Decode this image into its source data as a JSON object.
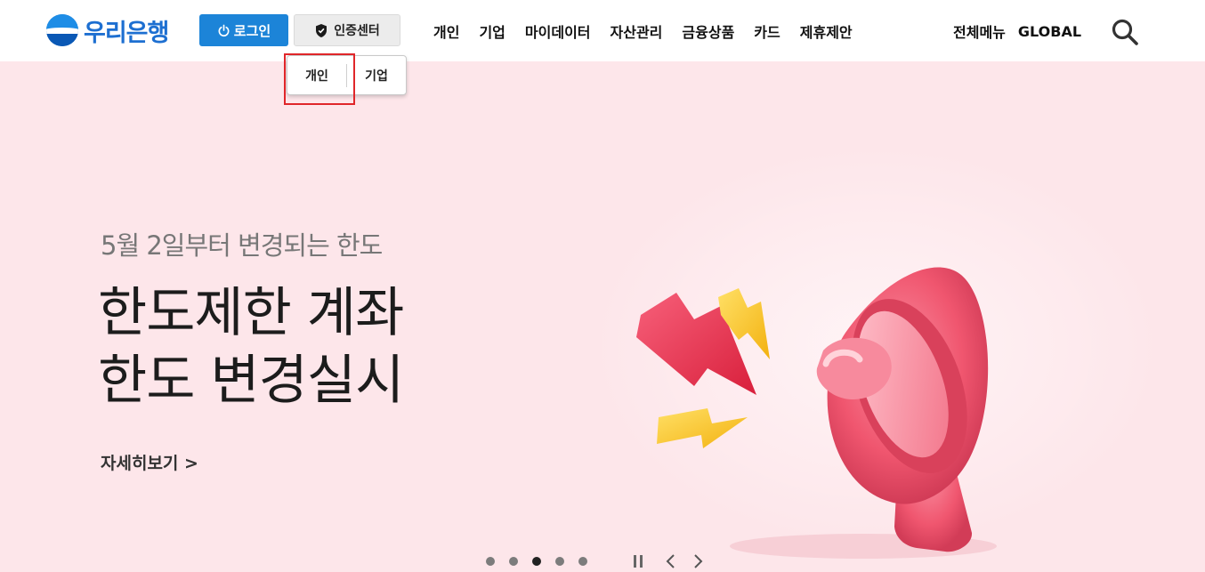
{
  "header": {
    "logo_text": "우리은행",
    "logo_icon": "woori-bank-logo-icon",
    "login_label": "로그인",
    "login_icon": "power-icon",
    "cert_label": "인증센터",
    "cert_icon": "shield-icon",
    "nav": [
      "개인",
      "기업",
      "마이데이터",
      "자산관리",
      "금융상품",
      "카드",
      "제휴제안"
    ],
    "all_menu": "전체메뉴",
    "global": "GLOBAL",
    "search_icon": "search-icon"
  },
  "cert_dropdown": {
    "items": [
      "개인",
      "기업"
    ],
    "highlighted": "개인"
  },
  "hero": {
    "subtitle": "5월 2일부터 변경되는 한도",
    "title_line1": "한도제한 계좌",
    "title_line2": "한도 변경실시",
    "link": "자세히보기 >",
    "illustration": "megaphone-icon"
  },
  "carousel": {
    "slide_count": 5,
    "active_index": 2,
    "pause_icon": "pause-icon",
    "prev_icon": "chevron-left-icon",
    "next_icon": "chevron-right-icon"
  },
  "colors": {
    "brand_blue": "#1c84d8",
    "hero_bg": "#fde6ea",
    "highlight_red": "#e0262a",
    "megaphone": "#f0566f",
    "bolt_red": "#e8344a",
    "bolt_yellow": "#f7c21a"
  }
}
